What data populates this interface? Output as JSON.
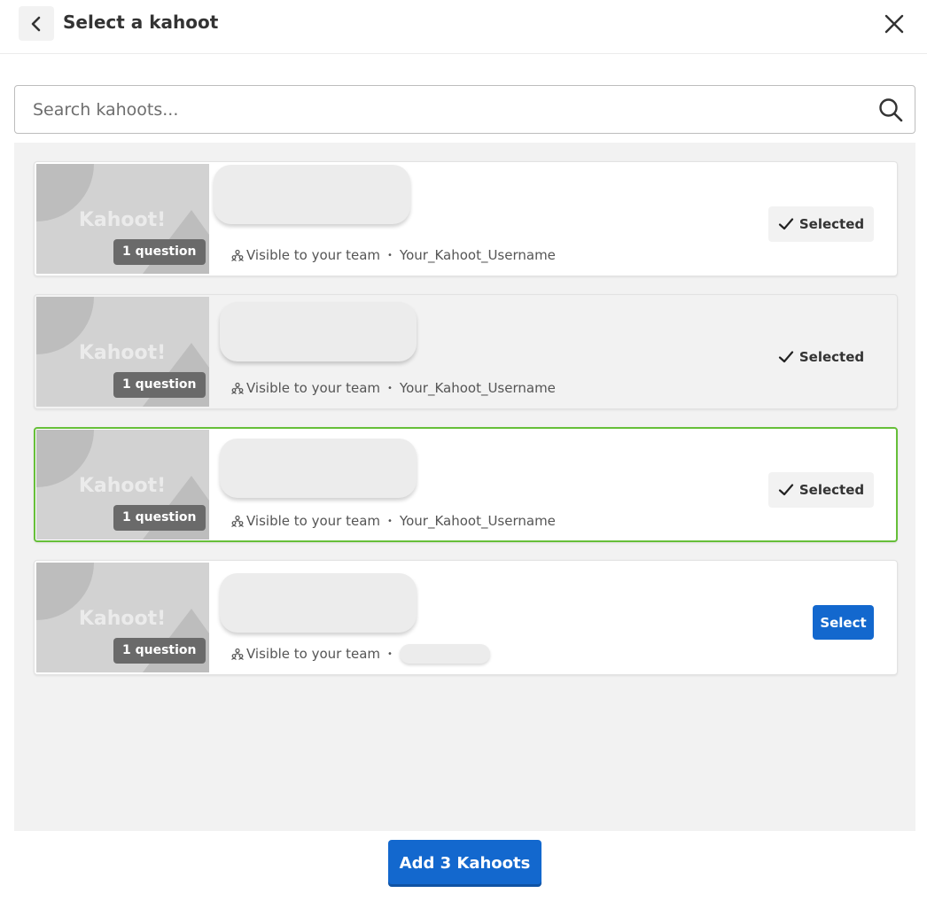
{
  "header": {
    "title": "Select a kahoot",
    "back_icon": "chevron-left-icon",
    "close_icon": "close-icon"
  },
  "search": {
    "placeholder": "Search kahoots...",
    "value": "",
    "icon": "search-icon"
  },
  "kahoots": [
    {
      "logo_text": "Kahoot!",
      "question_count": "1 question",
      "visibility": "Visible to your team",
      "separator": "•",
      "username": "Your_Kahoot_Username",
      "state": "selected",
      "button_label": "Selected"
    },
    {
      "logo_text": "Kahoot!",
      "question_count": "1 question",
      "visibility": "Visible to your team",
      "separator": "•",
      "username": "Your_Kahoot_Username",
      "state": "selected-hover",
      "button_label": "Selected"
    },
    {
      "logo_text": "Kahoot!",
      "question_count": "1 question",
      "visibility": "Visible to your team",
      "separator": "•",
      "username": "Your_Kahoot_Username",
      "state": "selected-focused",
      "button_label": "Selected"
    },
    {
      "logo_text": "Kahoot!",
      "question_count": "1 question",
      "visibility": "Visible to your team",
      "separator": "•",
      "username": "",
      "state": "unselected",
      "button_label": "Select"
    }
  ],
  "footer": {
    "add_button_label": "Add 3 Kahoots"
  },
  "colors": {
    "primary_blue": "#1368ce",
    "focus_green": "#66bf39",
    "badge_gray": "#6a6a6a",
    "list_bg": "#f2f2f2"
  }
}
